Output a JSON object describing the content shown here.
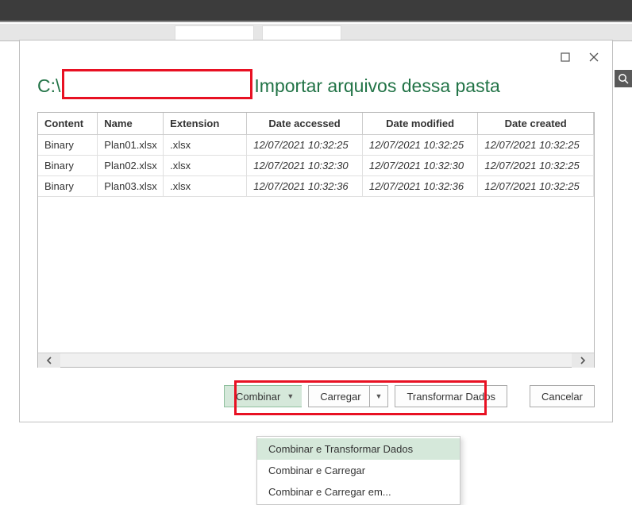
{
  "background": {
    "search_icon": "⌕"
  },
  "dialog": {
    "path_prefix": "C:\\",
    "title_suffix": "Importar arquivos dessa pasta",
    "columns": {
      "content": "Content",
      "name": "Name",
      "extension": "Extension",
      "date_accessed": "Date accessed",
      "date_modified": "Date modified",
      "date_created": "Date created"
    },
    "rows": [
      {
        "content": "Binary",
        "name": "Plan01.xlsx",
        "ext": ".xlsx",
        "accessed": "12/07/2021 10:32:25",
        "modified": "12/07/2021 10:32:25",
        "created": "12/07/2021 10:32:25"
      },
      {
        "content": "Binary",
        "name": "Plan02.xlsx",
        "ext": ".xlsx",
        "accessed": "12/07/2021 10:32:30",
        "modified": "12/07/2021 10:32:30",
        "created": "12/07/2021 10:32:25"
      },
      {
        "content": "Binary",
        "name": "Plan03.xlsx",
        "ext": ".xlsx",
        "accessed": "12/07/2021 10:32:36",
        "modified": "12/07/2021 10:32:36",
        "created": "12/07/2021 10:32:25"
      }
    ],
    "buttons": {
      "combinar": "Combinar",
      "carregar": "Carregar",
      "transformar": "Transformar Dados",
      "cancelar": "Cancelar"
    },
    "dropdown": [
      "Combinar e Transformar Dados",
      "Combinar e Carregar",
      "Combinar e Carregar em..."
    ]
  }
}
